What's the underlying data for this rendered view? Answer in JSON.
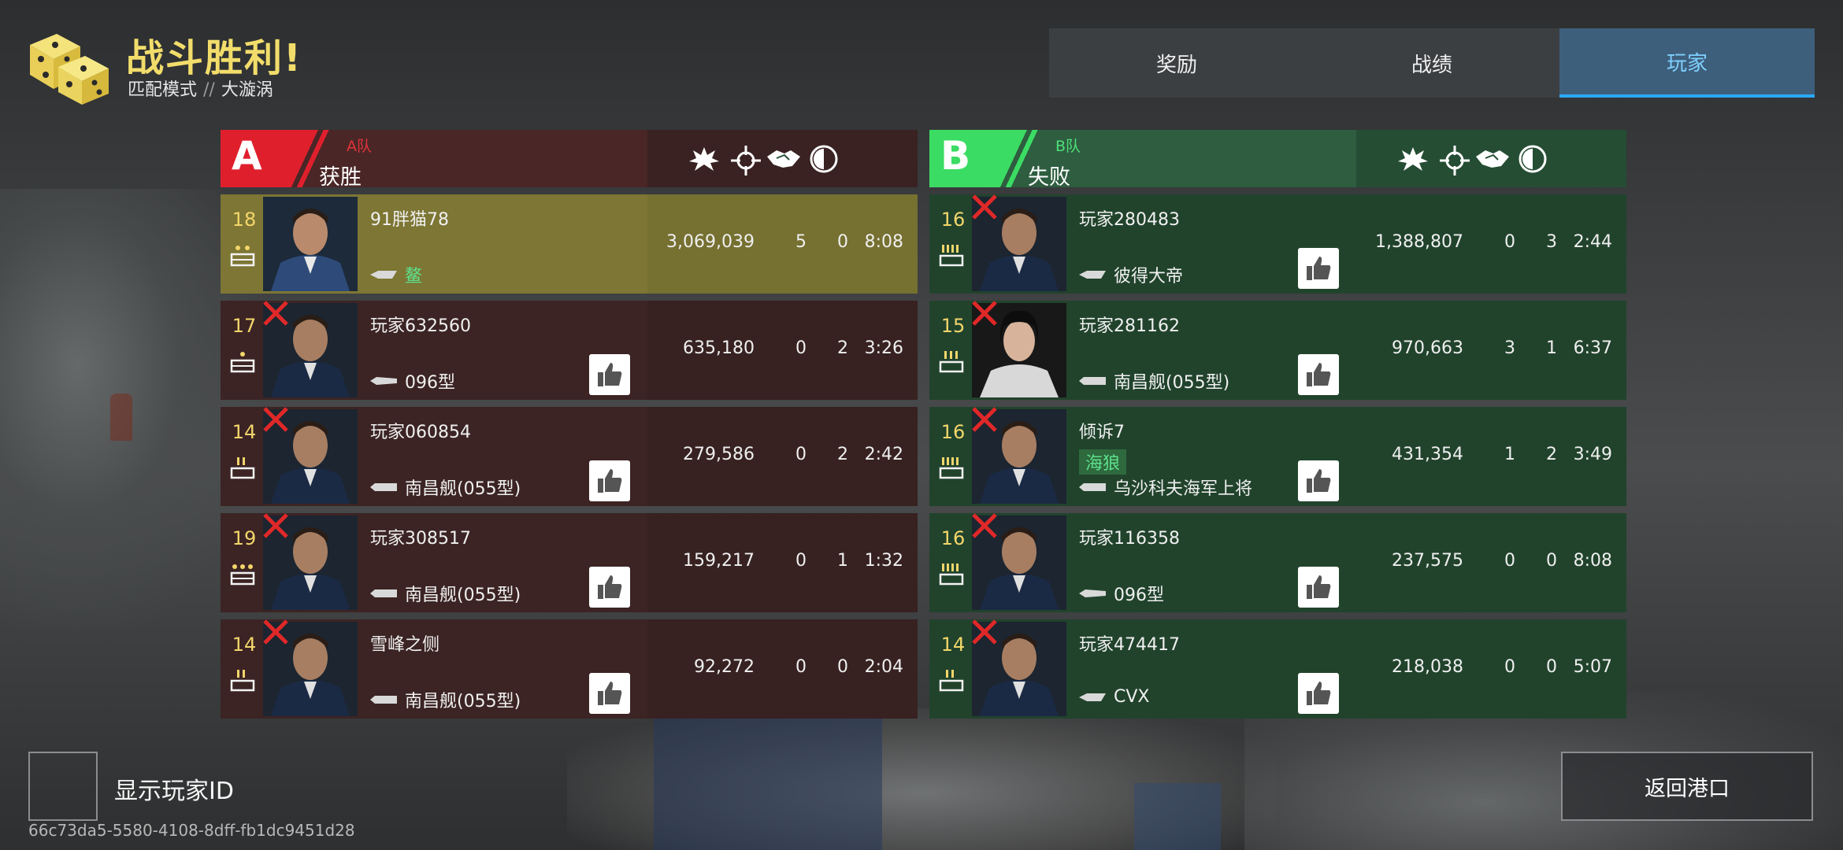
{
  "header": {
    "title": "战斗胜利!",
    "mode": "匹配模式",
    "separator": "//",
    "map": "大漩涡"
  },
  "tabs": [
    {
      "label": "奖励",
      "active": false
    },
    {
      "label": "战绩",
      "active": false
    },
    {
      "label": "玩家",
      "active": true
    }
  ],
  "team_a": {
    "letter": "A",
    "name": "A队",
    "result": "获胜",
    "color": "#e01f2d",
    "header_icons": [
      "damage-icon",
      "kill-icon",
      "assist-icon",
      "time-icon"
    ],
    "players": [
      {
        "level": "18",
        "name": "91胖猫78",
        "clan": "鳌",
        "ship": "",
        "score": "3,069,039",
        "kills": "5",
        "assists": "0",
        "time": "8:08",
        "destroyed": false,
        "highlight": true
      },
      {
        "level": "17",
        "name": "玩家632560",
        "clan": "",
        "ship": "096型",
        "score": "635,180",
        "kills": "0",
        "assists": "2",
        "time": "3:26",
        "destroyed": true,
        "highlight": false
      },
      {
        "level": "14",
        "name": "玩家060854",
        "clan": "",
        "ship": "南昌舰(055型)",
        "score": "279,586",
        "kills": "0",
        "assists": "2",
        "time": "2:42",
        "destroyed": true,
        "highlight": false
      },
      {
        "level": "19",
        "name": "玩家308517",
        "clan": "",
        "ship": "南昌舰(055型)",
        "score": "159,217",
        "kills": "0",
        "assists": "1",
        "time": "1:32",
        "destroyed": true,
        "highlight": false
      },
      {
        "level": "14",
        "name": "雪峰之侧",
        "clan": "",
        "ship": "南昌舰(055型)",
        "score": "92,272",
        "kills": "0",
        "assists": "0",
        "time": "2:04",
        "destroyed": true,
        "highlight": false
      }
    ]
  },
  "team_b": {
    "letter": "B",
    "name": "B队",
    "result": "失败",
    "color": "#3bdc63",
    "header_icons": [
      "damage-icon",
      "kill-icon",
      "assist-icon",
      "time-icon"
    ],
    "players": [
      {
        "level": "16",
        "name": "玩家280483",
        "clan": "",
        "ship": "彼得大帝",
        "score": "1,388,807",
        "kills": "0",
        "assists": "3",
        "time": "2:44",
        "destroyed": true
      },
      {
        "level": "15",
        "name": "玩家281162",
        "clan": "",
        "ship": "南昌舰(055型)",
        "score": "970,663",
        "kills": "3",
        "assists": "1",
        "time": "6:37",
        "destroyed": true
      },
      {
        "level": "16",
        "name": "倾诉7",
        "clan": "海狼",
        "ship": "乌沙科夫海军上将",
        "score": "431,354",
        "kills": "1",
        "assists": "2",
        "time": "3:49",
        "destroyed": true
      },
      {
        "level": "16",
        "name": "玩家116358",
        "clan": "",
        "ship": "096型",
        "score": "237,575",
        "kills": "0",
        "assists": "0",
        "time": "8:08",
        "destroyed": true
      },
      {
        "level": "14",
        "name": "玩家474417",
        "clan": "",
        "ship": "CVX",
        "score": "218,038",
        "kills": "0",
        "assists": "0",
        "time": "5:07",
        "destroyed": true
      }
    ]
  },
  "footer": {
    "show_id_label": "显示玩家ID",
    "player_id": "66c73da5-5580-4108-8dff-fb1dc9451d28",
    "return_label": "返回港口"
  }
}
